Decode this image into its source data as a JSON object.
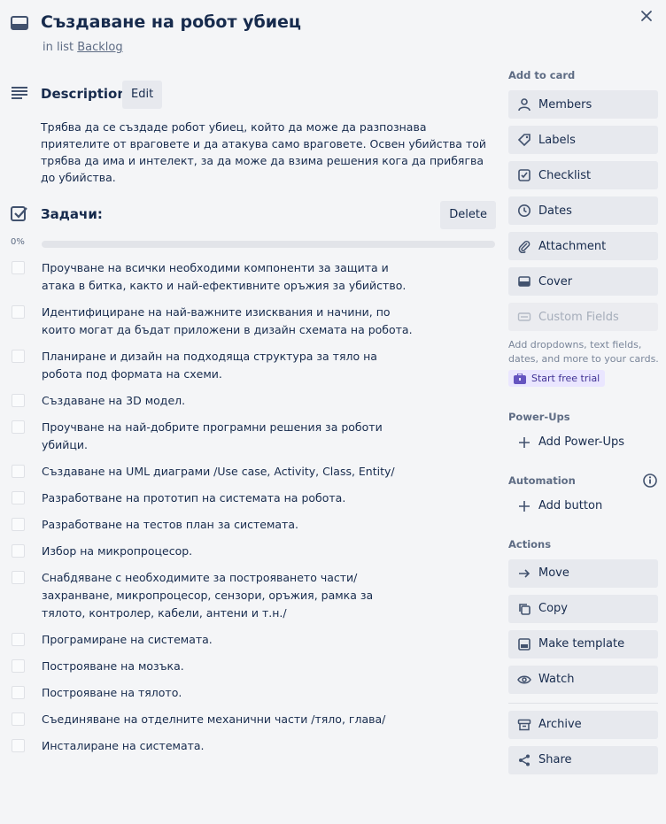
{
  "card": {
    "title": "Създаване на робот убиец",
    "in_list_prefix": "in list",
    "list_name": "Backlog"
  },
  "description": {
    "title": "Description",
    "edit_label": "Edit",
    "text": "Трябва да се създаде робот убиец, който да може да разпознава приятелите от враговете и да атакува само враговете. Освен убийства той трябва да има и интелект, за да може да взима решения кога да прибягва до убийства."
  },
  "checklist": {
    "title": "Задачи:",
    "delete_label": "Delete",
    "progress_label": "0%",
    "progress": 0,
    "items": [
      "Проучване на всички необходими компоненти за защита и атака в битка, както и най-ефективните оръжия за убийство.",
      "Идентифициране на най-важните изисквания и начини, по които могат да бъдат приложени в дизайн схемата на робота.",
      "Планиране и дизайн на подходяща структура за тяло на робота под формата на схеми.",
      "Създаване на 3D модел.",
      "Проучване на най-добрите програмни решения за роботи убийци.",
      "Създаване на UML диаграми /Use case, Activity, Class, Entity/",
      "Разработване на прототип на системата на робота.",
      "Разработване на тестов план за системата.",
      "Избор на микропроцесор.",
      "Снабдяване с необходимите за построяването части/ захранване, микропроцесор, сензори, оръжия, рамка за тялото, контролер, кабели, антени и т.н./",
      "Програмиране на системата.",
      "Построяване на мозъка.",
      "Построяване на тялото.",
      "Съединяване на отделните механични части /тяло, глава/",
      "Инсталиране на системата."
    ]
  },
  "sidebar": {
    "add_to_card_title": "Add to card",
    "add_to_card": [
      {
        "label": "Members",
        "icon": "person-icon"
      },
      {
        "label": "Labels",
        "icon": "tag-icon"
      },
      {
        "label": "Checklist",
        "icon": "checkbox-icon"
      },
      {
        "label": "Dates",
        "icon": "clock-icon"
      },
      {
        "label": "Attachment",
        "icon": "paperclip-icon"
      },
      {
        "label": "Cover",
        "icon": "card-cover-icon"
      },
      {
        "label": "Custom Fields",
        "icon": "custom-fields-icon"
      }
    ],
    "custom_fields_note": "Add dropdowns, text fields, dates, and more to your cards.",
    "start_trial_label": "Start free trial",
    "powerups_title": "Power-Ups",
    "add_powerups_label": "Add Power-Ups",
    "automation_title": "Automation",
    "add_button_label": "Add button",
    "actions_title": "Actions",
    "actions": [
      {
        "label": "Move",
        "icon": "arrow-right-icon"
      },
      {
        "label": "Copy",
        "icon": "copy-icon"
      },
      {
        "label": "Make template",
        "icon": "template-icon"
      },
      {
        "label": "Watch",
        "icon": "eye-icon"
      }
    ],
    "actions_secondary": [
      {
        "label": "Archive",
        "icon": "archive-icon"
      },
      {
        "label": "Share",
        "icon": "share-icon"
      }
    ]
  },
  "colors": {
    "background": "#f4f5f7",
    "button": "#e7e9ee",
    "text": "#172b4d",
    "muted": "#5e6c84",
    "trial_bg": "#eae6ff",
    "progress_fill": "#5ba4cf"
  }
}
